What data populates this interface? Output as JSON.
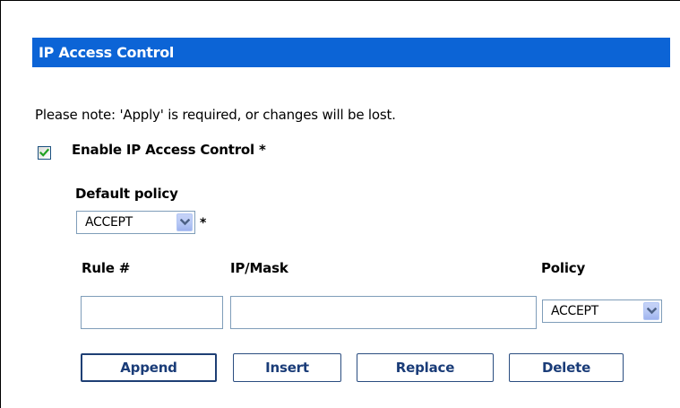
{
  "section": {
    "title": "IP Access Control"
  },
  "note": "Please note: 'Apply' is required, or changes will be lost.",
  "enable": {
    "label": "Enable IP Access Control *",
    "checked": true
  },
  "default_policy": {
    "label": "Default policy",
    "value": "ACCEPT",
    "required_mark": "*"
  },
  "rules_table": {
    "columns": [
      "Rule #",
      "IP/Mask",
      "Policy"
    ],
    "rule_number_value": "",
    "ip_mask_value": "",
    "policy_value": "ACCEPT"
  },
  "buttons": {
    "append": "Append",
    "insert": "Insert",
    "replace": "Replace",
    "delete": "Delete"
  },
  "colors": {
    "header_bg": "#0c64d6",
    "header_text": "#ffffff",
    "button_text": "#1a3c78",
    "checkmark": "#21a121"
  }
}
